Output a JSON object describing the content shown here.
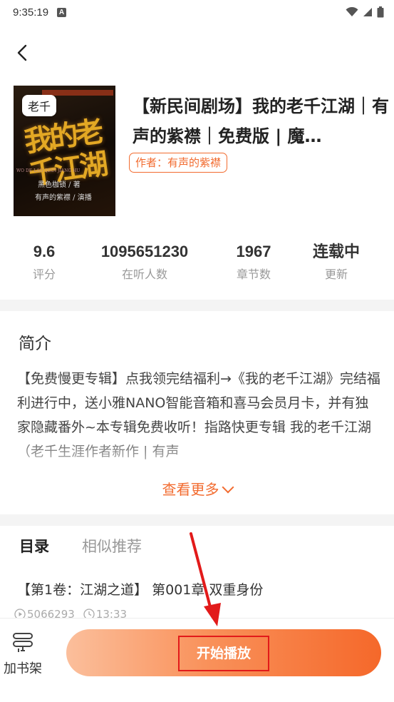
{
  "status_bar": {
    "time": "9:35:19",
    "notification_badge": "A",
    "icons": [
      "wifi-icon",
      "signal-icon",
      "battery-icon"
    ]
  },
  "cover": {
    "tag": "老千",
    "art_title": "我的老千江湖",
    "art_credit_line1": "黑色枷锁 / 著",
    "art_credit_line2": "有声的紫襟 / 演播",
    "art_pinyin": "WO DE LAO QIAN JIANG HU"
  },
  "album": {
    "title": "【新民间剧场】我的老千江湖｜有声的紫襟｜免费版 | 魔…",
    "author_tag": "作者：有声的紫襟"
  },
  "stats": [
    {
      "value": "9.6",
      "label": "评分"
    },
    {
      "value": "1095651230",
      "label": "在听人数"
    },
    {
      "value": "1967",
      "label": "章节数"
    },
    {
      "value": "连载中",
      "label": "更新"
    }
  ],
  "intro": {
    "heading": "简介",
    "text": "【免费慢更专辑】点我领完结福利→《我的老千江湖》完结福利进行中，送小雅NANO智能音箱和喜马会员月卡，并有独家隐藏番外~本专辑免费收听！指路快更专辑 我的老千江湖（老千生涯作者新作 | 有声",
    "more_label": "查看更多"
  },
  "tabs": [
    {
      "label": "目录",
      "active": true
    },
    {
      "label": "相似推荐",
      "active": false
    }
  ],
  "chapter": {
    "title": "【第1卷：江湖之道】 第001章 双重身份",
    "plays": "5066293",
    "duration": "13:33"
  },
  "bottom": {
    "shelf_label": "加书架",
    "play_label": "开始播放"
  },
  "colors": {
    "accent": "#f26b2f",
    "highlight_box": "#e21a1a"
  }
}
